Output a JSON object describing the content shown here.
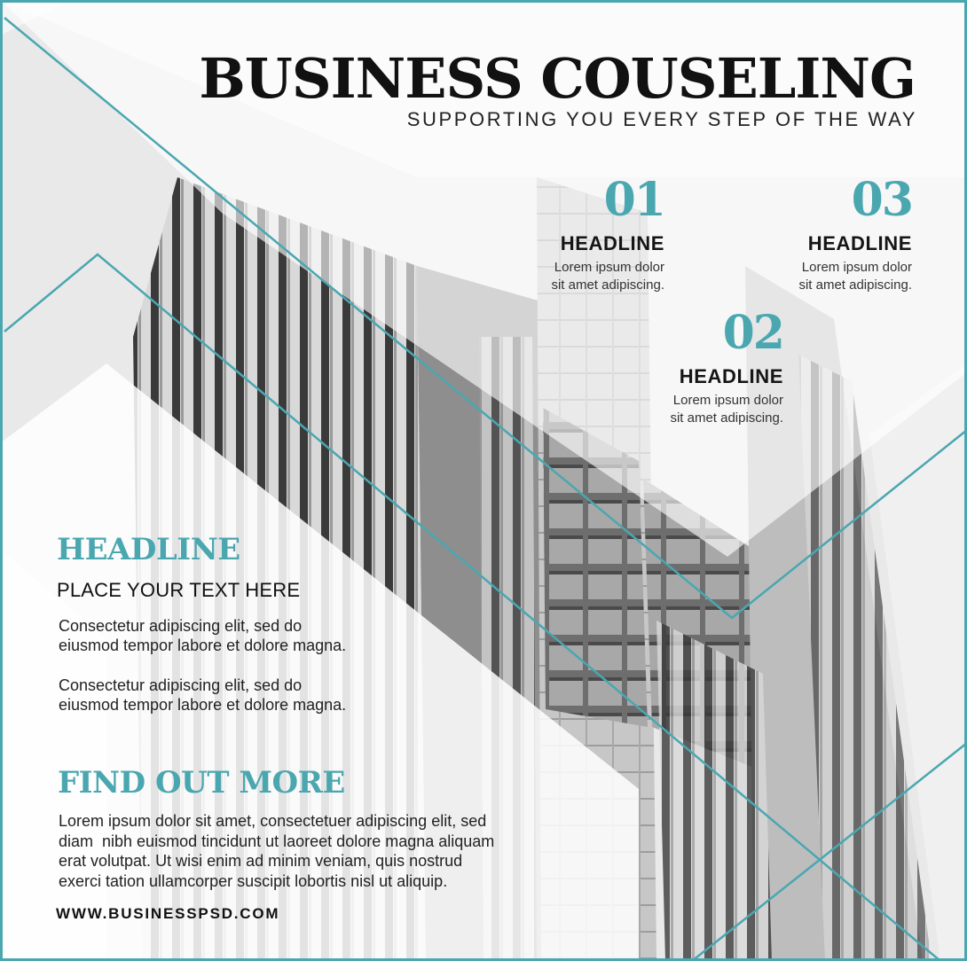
{
  "title": "BUSINESS COUSELING",
  "subtitle": "SUPPORTING YOU EVERY STEP OF THE WAY",
  "features": [
    {
      "number": "01",
      "headline": "HEADLINE",
      "line1": "Lorem ipsum dolor",
      "line2": "sit amet adipiscing."
    },
    {
      "number": "02",
      "headline": "HEADLINE",
      "line1": "Lorem ipsum dolor",
      "line2": "sit amet adipiscing."
    },
    {
      "number": "03",
      "headline": "HEADLINE",
      "line1": "Lorem ipsum dolor",
      "line2": "sit amet adipiscing."
    }
  ],
  "left": {
    "headline": "HEADLINE",
    "subhead": "PLACE YOUR TEXT HERE",
    "paragraphs": [
      {
        "line1": "Consectetur adipiscing elit, sed do",
        "line2": "eiusmod tempor labore et dolore magna."
      },
      {
        "line1": "Consectetur adipiscing elit, sed do",
        "line2": "eiusmod tempor labore et dolore magna."
      }
    ]
  },
  "find_out_more": {
    "headline": "FIND OUT MORE",
    "lines": [
      "Lorem ipsum dolor sit amet, consectetuer adipiscing elit, sed",
      "diam  nibh euismod tincidunt ut laoreet dolore magna aliquam",
      "erat volutpat. Ut wisi enim ad minim veniam, quis nostrud",
      "exerci tation ullamcorper suscipit lobortis nisl ut aliquip."
    ]
  },
  "website": "WWW.BUSINESSPSD.COM",
  "colors": {
    "accent": "#4aa7b0",
    "text": "#111111",
    "panel": "#ffffff"
  },
  "background_image": "grayscale skyscraper photo"
}
